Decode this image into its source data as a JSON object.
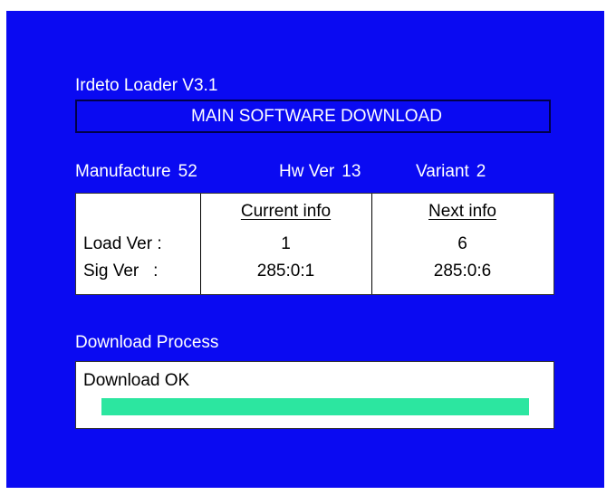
{
  "loader_title": "Irdeto Loader V3.1",
  "header": "MAIN SOFTWARE DOWNLOAD",
  "info": {
    "manufacture_label": "Manufacture",
    "manufacture_value": "52",
    "hw_ver_label": "Hw Ver",
    "hw_ver_value": "13",
    "variant_label": "Variant",
    "variant_value": "2"
  },
  "table": {
    "current_header": "Current info",
    "next_header": "Next info",
    "rows": [
      {
        "label": "Load Ver :",
        "current": "1",
        "next": "6"
      },
      {
        "label": "Sig Ver   :",
        "current": "285:0:1",
        "next": "285:0:6"
      }
    ]
  },
  "process": {
    "label": "Download Process",
    "status": "Download OK",
    "progress": 1.0
  },
  "colors": {
    "screen_bg": "#0a0af2",
    "progress_fill": "#2ce6a0",
    "panel_bg": "#ffffff"
  }
}
